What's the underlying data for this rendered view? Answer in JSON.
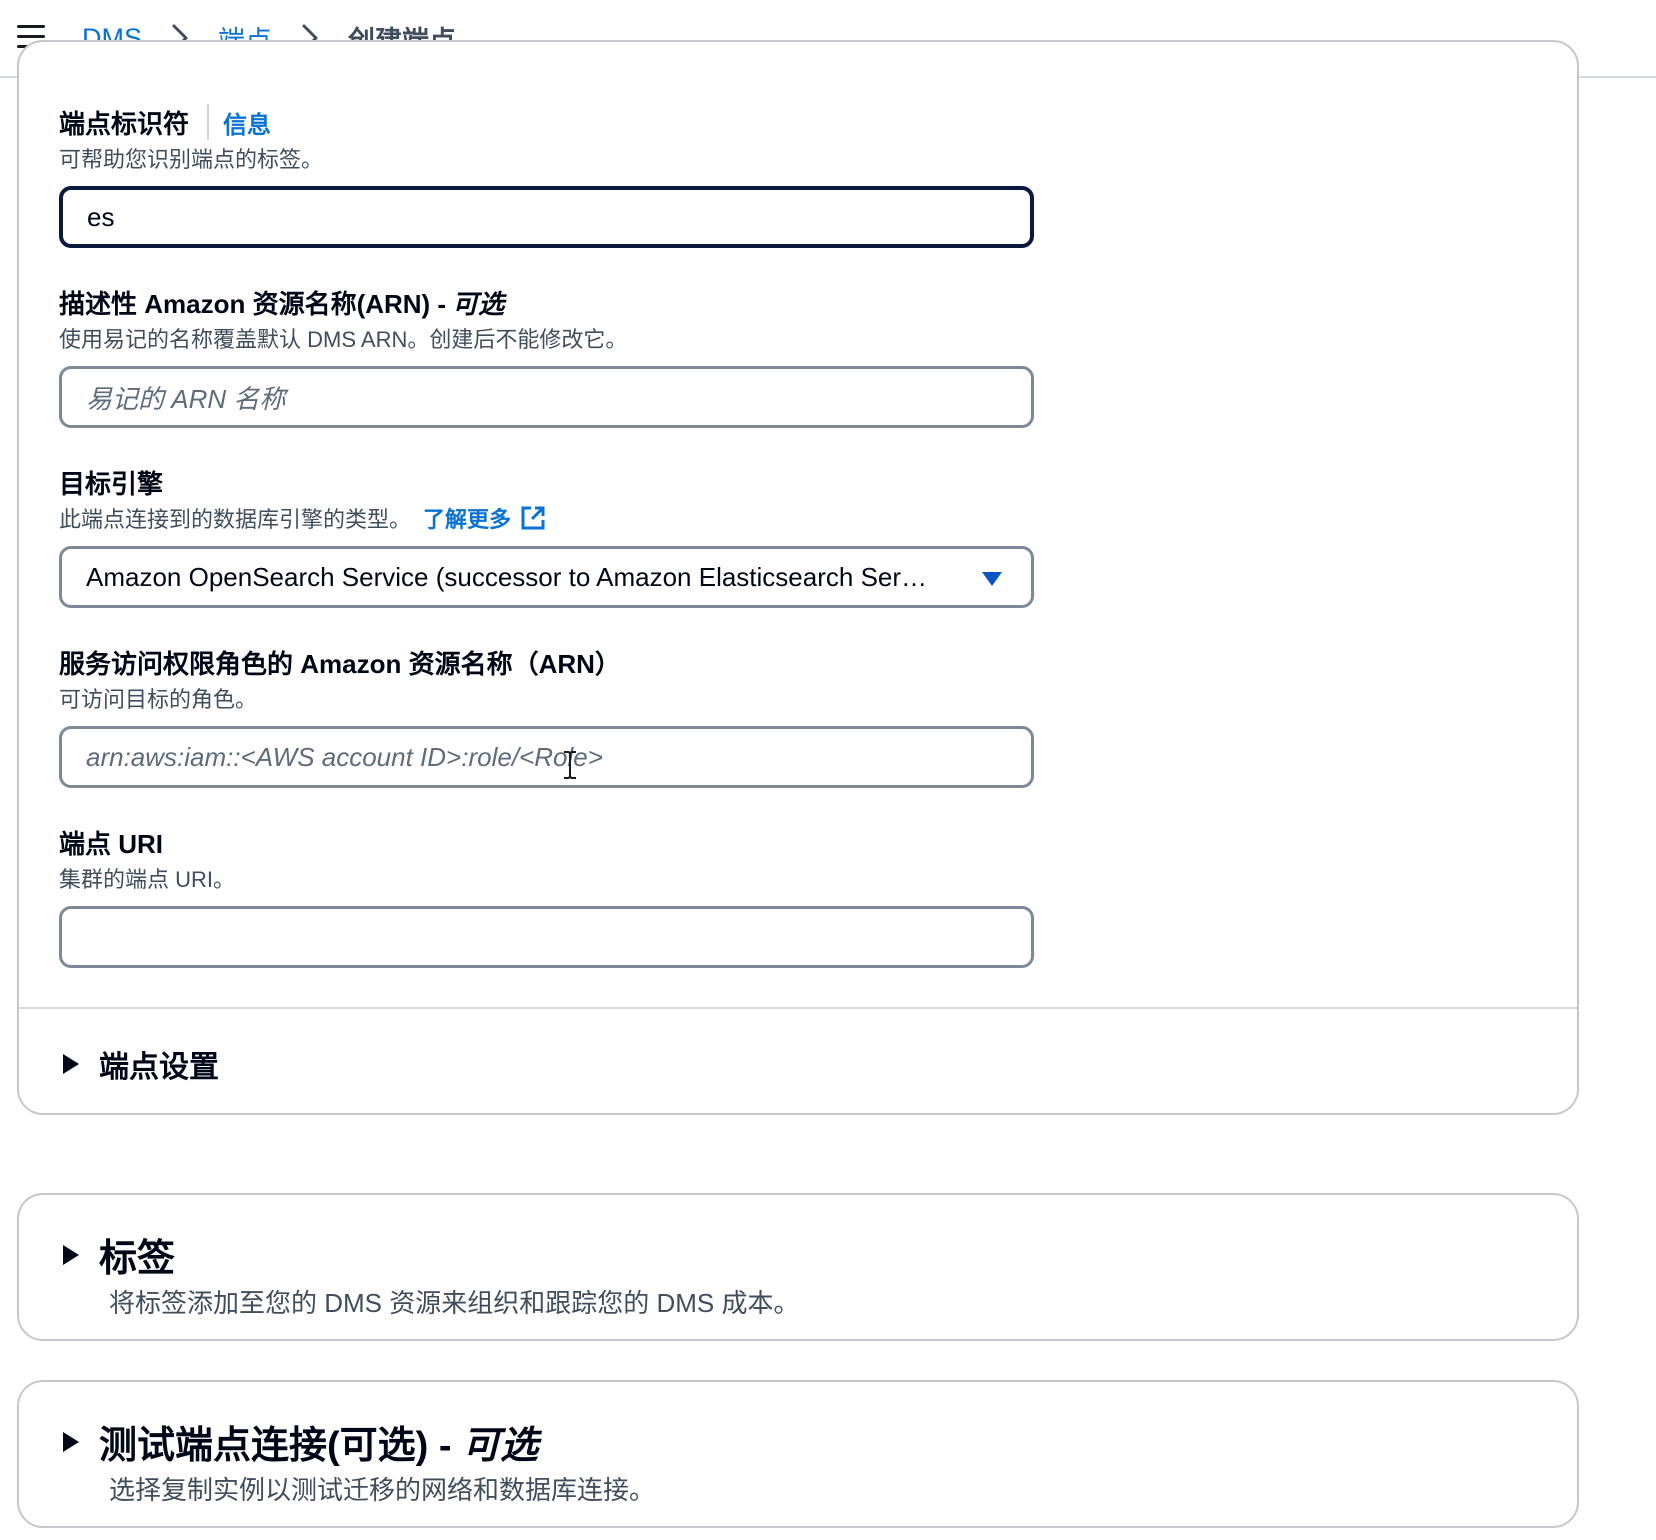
{
  "breadcrumb": {
    "items": [
      "DMS",
      "端点",
      "创建端点"
    ]
  },
  "fields": {
    "endpoint_id": {
      "label": "端点标识符",
      "info": "信息",
      "description": "可帮助您识别端点的标签。",
      "value": "es"
    },
    "arn": {
      "label": "描述性 Amazon 资源名称(ARN) -",
      "label_optional": "可选",
      "description": "使用易记的名称覆盖默认 DMS ARN。创建后不能修改它。",
      "placeholder": "易记的 ARN 名称"
    },
    "target_engine": {
      "label": "目标引擎",
      "description": "此端点连接到的数据库引擎的类型。",
      "learn_more": "了解更多",
      "selected": "Amazon OpenSearch Service (successor to Amazon Elasticsearch Ser…"
    },
    "role_arn": {
      "label": "服务访问权限角色的 Amazon 资源名称（ARN）",
      "description": "可访问目标的角色。",
      "placeholder": "arn:aws:iam::<AWS account ID>:role/<Role>"
    },
    "endpoint_uri": {
      "label": "端点 URI",
      "description": "集群的端点 URI。",
      "value": ""
    }
  },
  "sections": {
    "endpoint_settings": "端点设置",
    "tags": {
      "title": "标签",
      "description": "将标签添加至您的 DMS 资源来组织和跟踪您的 DMS 成本。"
    },
    "test_connection": {
      "title": "测试端点连接(可选) -",
      "title_optional": "可选",
      "description": "选择复制实例以测试迁移的网络和数据库连接。"
    }
  },
  "colors": {
    "link": "#0972d3",
    "focus_border": "#0a1a3f",
    "input_border": "#7d8998",
    "card_border": "#c6c6cd"
  },
  "icons": [
    "menu-icon",
    "chevron-right-icon",
    "external-link-icon",
    "caret-down-icon",
    "text-cursor-icon",
    "triangle-right-icon"
  ]
}
